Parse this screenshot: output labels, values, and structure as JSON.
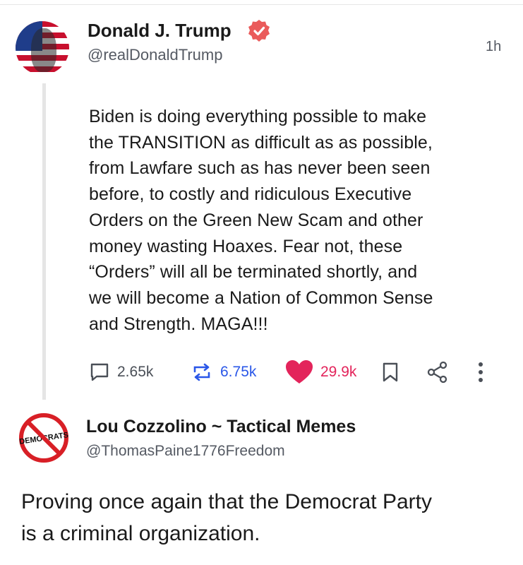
{
  "post1": {
    "author_name": "Donald J. Trump",
    "handle": "@realDonaldTrump",
    "time": "1h",
    "body_lines": [
      "Biden is doing everything possible to make",
      "the TRANSITION as difficult as as possible,",
      "from Lawfare such as has never been seen",
      "before, to costly and ridiculous Executive",
      "Orders on the Green New Scam and other",
      "money wasting Hoaxes. Fear not, these",
      "“Orders” will all be terminated shortly, and",
      "we will become a Nation of Common Sense",
      "and Strength. MAGA!!!"
    ],
    "replies": "2.65k",
    "retruths": "6.75k",
    "likes": "29.9k",
    "verified_color": "#ea5b5b",
    "icons": [
      "reply-icon",
      "retruth-icon",
      "heart-icon",
      "bookmark-icon",
      "share-icon",
      "more-icon"
    ]
  },
  "post2": {
    "author_name": "Lou Cozzolino ~ Tactical Memes",
    "handle": "@ThomasPaine1776Freedom",
    "avatar_text": "DEMOCRATS",
    "body_lines": [
      "Proving once again that the Democrat Party",
      "is a criminal organization."
    ]
  },
  "colors": {
    "retruth": "#2a57e8",
    "like": "#e3245b",
    "muted": "#555a63"
  }
}
